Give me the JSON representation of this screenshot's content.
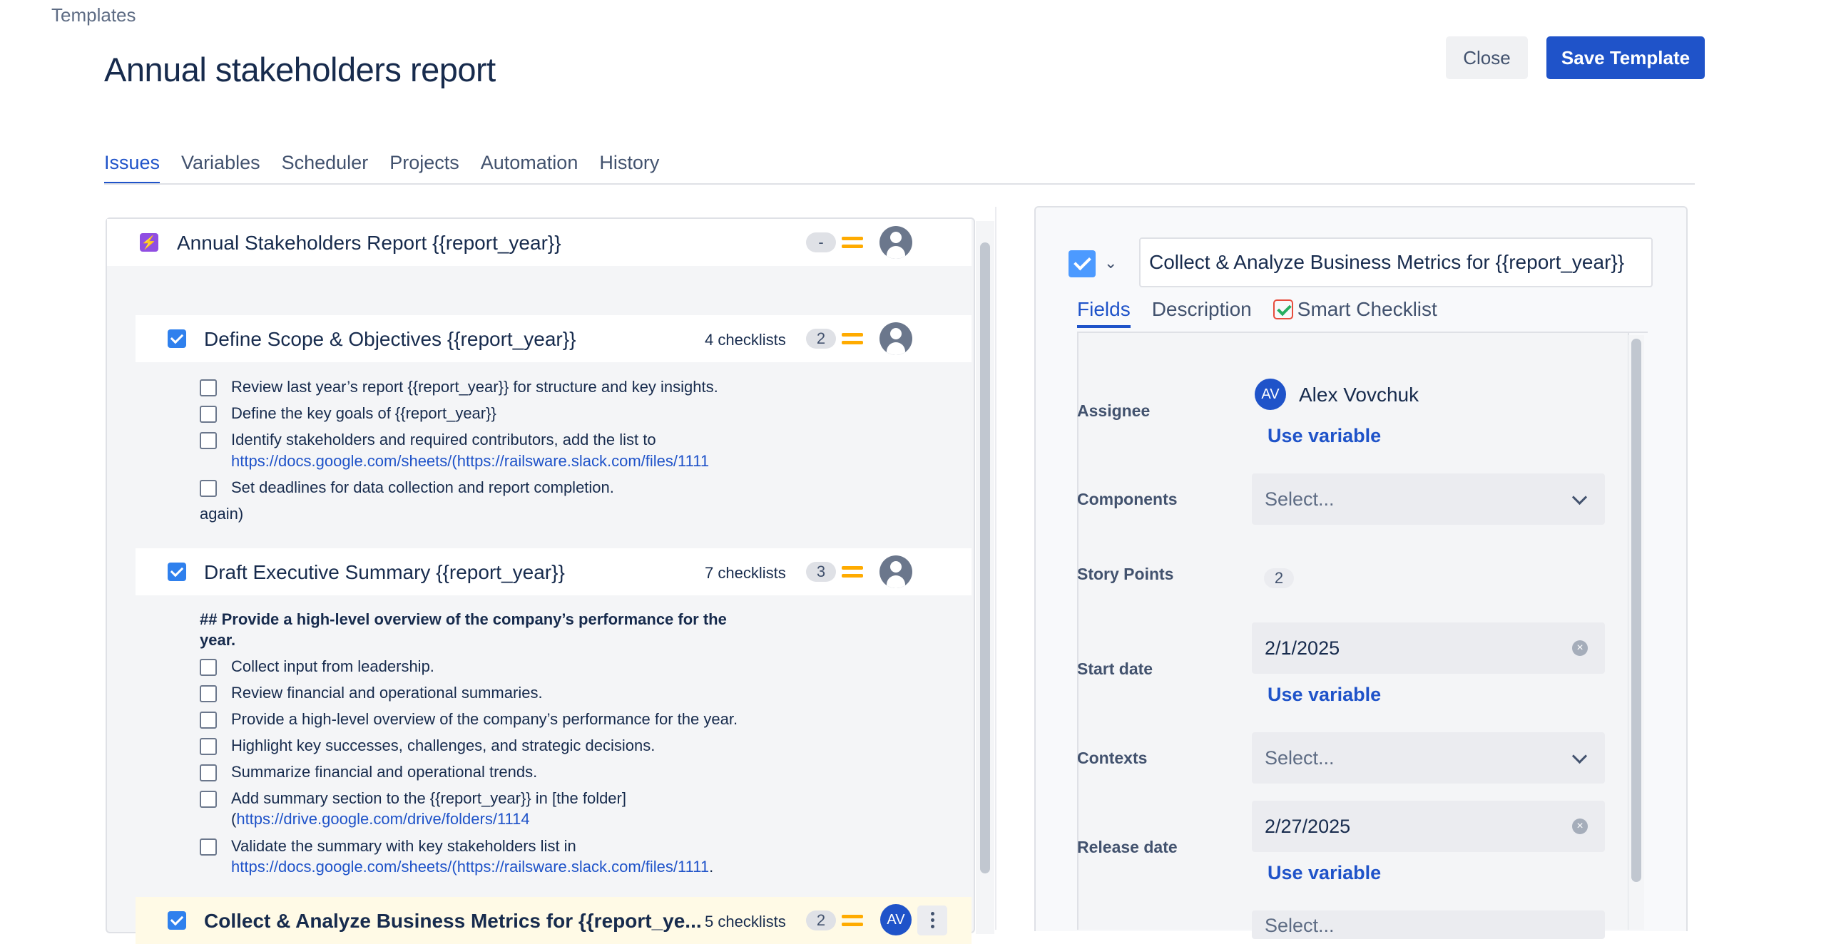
{
  "breadcrumb": "Templates",
  "page_title": "Annual stakeholders report",
  "header": {
    "close_label": "Close",
    "save_label": "Save Template"
  },
  "tabs": [
    "Issues",
    "Variables",
    "Scheduler",
    "Projects",
    "Automation",
    "History"
  ],
  "active_tab": "Issues",
  "colors": {
    "primary": "#1f53c9",
    "epic": "#904ee2",
    "priority": "#ffab00",
    "highlight_row": "#fffae6"
  },
  "parent_issue": {
    "title": "Annual Stakeholders Report {{report_year}}",
    "estimate": "-",
    "icon": "epic-lightning-icon"
  },
  "children": [
    {
      "title": "Define Scope & Objectives {{report_year}}",
      "checklists": "4 checklists",
      "story_points": "2",
      "items": [
        {
          "text": "Review last year’s report {{report_year}} for structure and key insights."
        },
        {
          "text": "Define the key goals of {{report_year}}"
        },
        {
          "text": "Identify stakeholders and required contributors, add the list to",
          "link": "https://docs.google.com/sheets/(https://railsware.slack.com/files/1111"
        },
        {
          "text": "Set deadlines for data collection and report completion."
        }
      ],
      "trailing": "again)"
    },
    {
      "title": "Draft Executive Summary {{report_year}}",
      "checklists": "7 checklists",
      "story_points": "3",
      "heading_line1": "## Provide a high-level overview of the company’s performance for the",
      "heading_line2": "year.",
      "items": [
        {
          "text": "Collect input from leadership."
        },
        {
          "text": "Review financial and operational summaries."
        },
        {
          "text": "Provide a high-level overview of the company’s performance for the year."
        },
        {
          "text": "Highlight key successes, challenges, and strategic decisions."
        },
        {
          "text": "Summarize financial and operational trends."
        },
        {
          "text": "Add summary section to the {{report_year}} in [the folder]",
          "link_prefix": "(",
          "link": "https://drive.google.com/drive/folders/1114"
        },
        {
          "text": "Validate the summary with key stakeholders list in",
          "link": "https://docs.google.com/sheets/(https://railsware.slack.com/files/1111",
          "link_suffix": "."
        }
      ]
    },
    {
      "title": "Collect & Analyze Business Metrics for {{report_ye...",
      "checklists": "5 checklists",
      "story_points": "2",
      "assignee_initials": "AV"
    }
  ],
  "detail": {
    "title_value": "Collect & Analyze Business Metrics for {{report_year}}",
    "tabs": [
      "Fields",
      "Description",
      "Smart Checklist"
    ],
    "active_tab": "Fields",
    "fields": {
      "assignee_label": "Assignee",
      "assignee_initials": "AV",
      "assignee_name": "Alex Vovchuk",
      "use_variable": "Use variable",
      "components_label": "Components",
      "components_value": "Select...",
      "story_points_label": "Story Points",
      "story_points_value": "2",
      "start_date_label": "Start date",
      "start_date_value": "2/1/2025",
      "contexts_label": "Contexts",
      "contexts_value": "Select...",
      "release_date_label": "Release date",
      "release_date_value": "2/27/2025",
      "next_value": "Select..."
    }
  }
}
